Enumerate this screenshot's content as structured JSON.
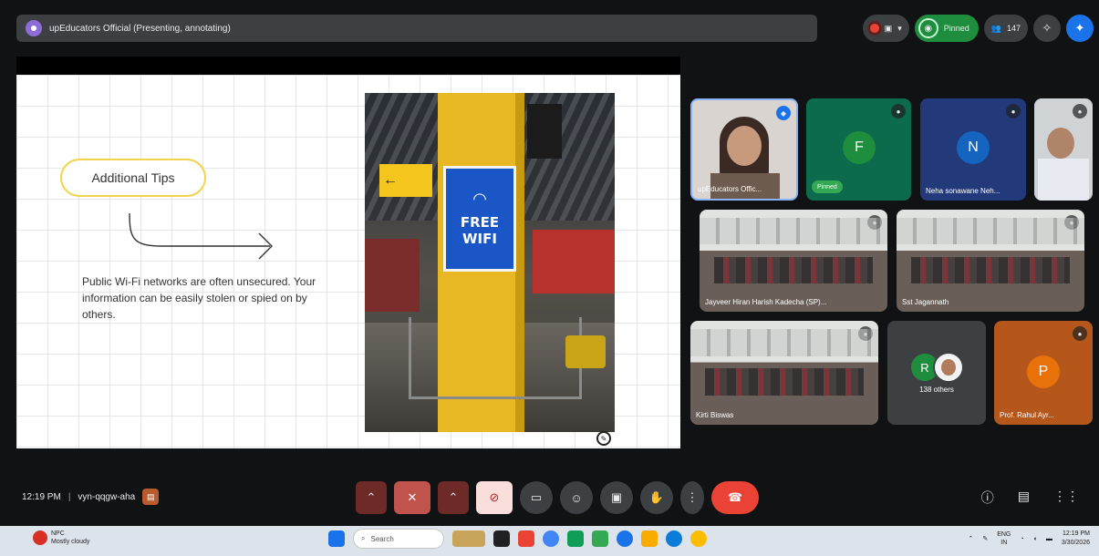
{
  "topbar": {
    "presenter": "upEducators Official (Presenting, annotating)"
  },
  "top_right": {
    "pinned_label": "Pinned",
    "people_count": "147"
  },
  "slide": {
    "tips_title": "Additional Tips",
    "tips_body": "Public Wi-Fi networks are often unsecured. Your information can be easily stolen or spied on by others.",
    "sign_line1": "FREE",
    "sign_line2": "WIFI"
  },
  "tiles": [
    {
      "name": "upEducators Offic..."
    },
    {
      "initial": "F",
      "badge": "Pinned",
      "color": "#0b6b4c",
      "avatar_color": "#1e8e3e"
    },
    {
      "initial": "N",
      "name": "Neha sonawane Neh...",
      "color": "#233a7a",
      "avatar_color": "#1565c0"
    },
    {
      "name": ""
    },
    {
      "name": "Jayveer Hiran Harish Kadecha (SP)..."
    },
    {
      "name": "Sst Jagannath"
    },
    {
      "name": "Kirti Biswas"
    },
    {
      "initial": "R",
      "name": "138 others"
    },
    {
      "initial": "P",
      "name": "Prof. Rahul Ayr...",
      "color": "#b5561a",
      "avatar_color": "#e8710a"
    }
  ],
  "bottom": {
    "time": "12:19 PM",
    "meeting_code": "vyn-qqgw-aha"
  },
  "taskbar": {
    "weather_temp": "NPC",
    "weather_desc": "Mostly cloudy",
    "search_placeholder": "Search",
    "lang": "ENG",
    "lang2": "IN",
    "clock_time": "12:19 PM",
    "clock_date": "3/30/2026"
  }
}
